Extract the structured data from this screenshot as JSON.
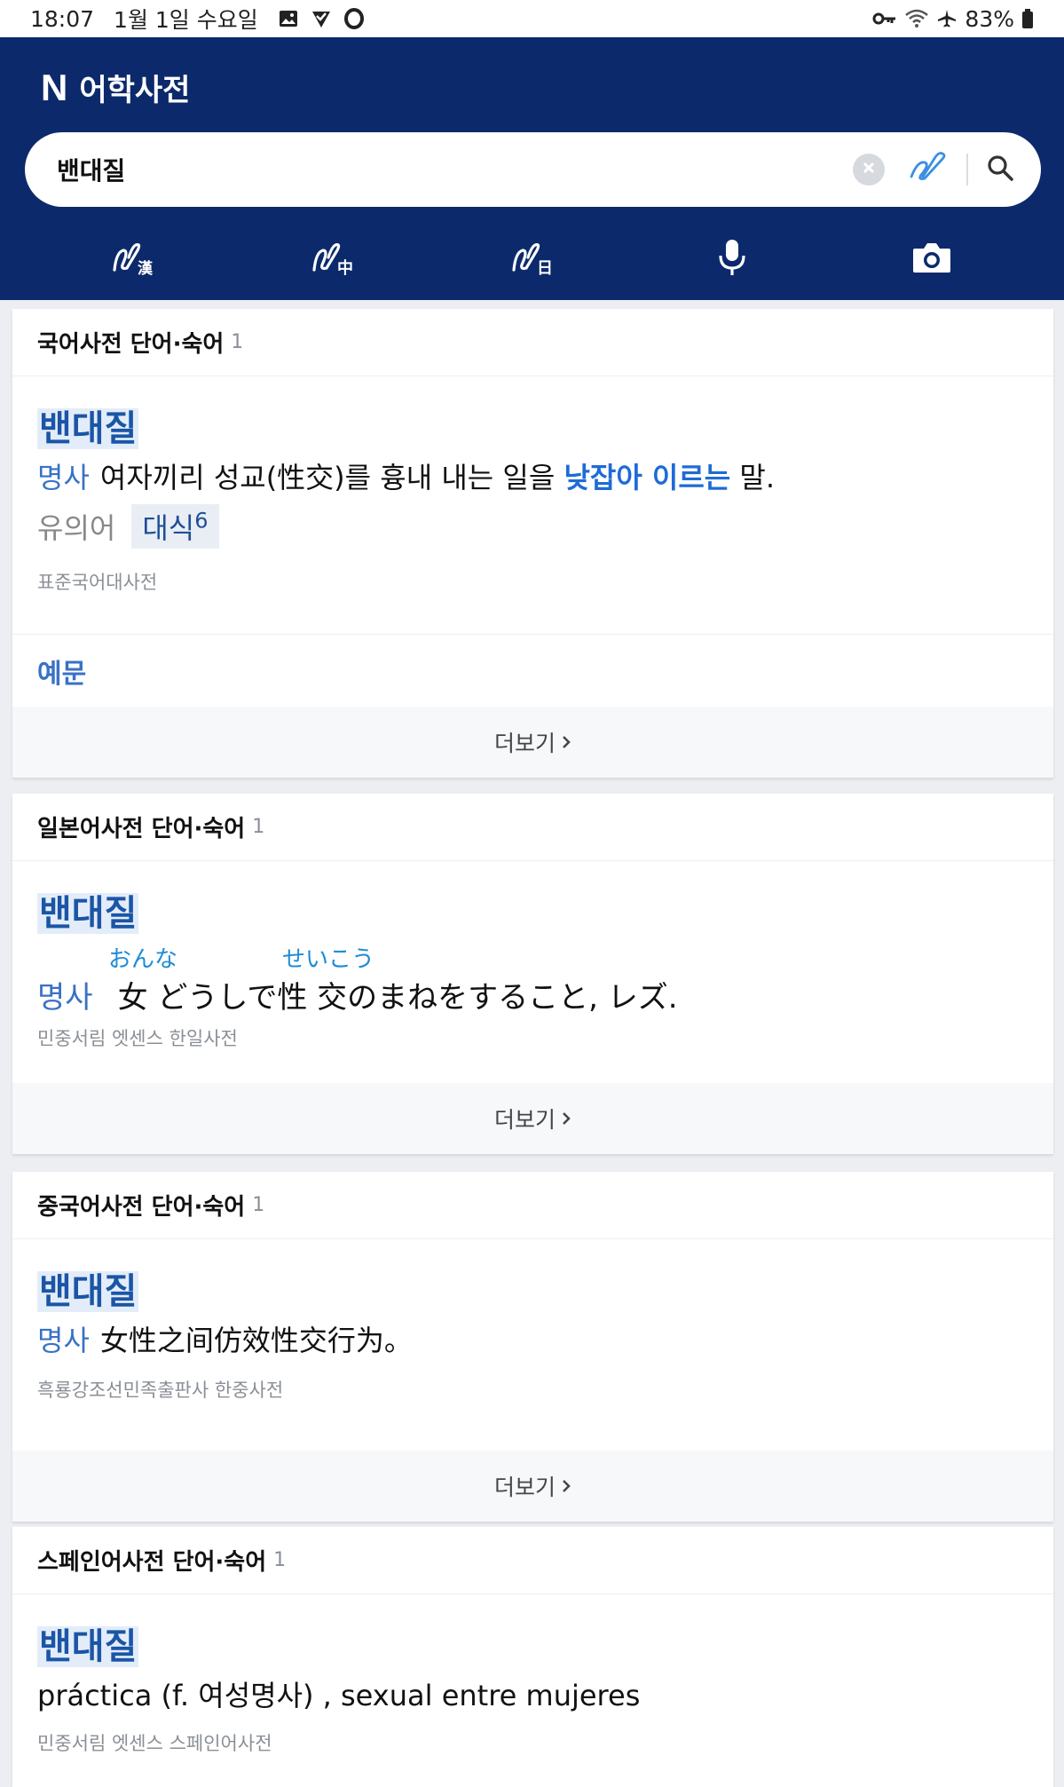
{
  "status": {
    "time": "18:07",
    "date": "1월 1일 수요일",
    "battery": "83%"
  },
  "header": {
    "logo": "N",
    "title": "어학사전"
  },
  "search": {
    "value": "밴대질"
  },
  "tools": [
    {
      "icon": "handwriting-hanja-icon"
    },
    {
      "icon": "handwriting-chinese-icon"
    },
    {
      "icon": "handwriting-japanese-icon"
    },
    {
      "icon": "microphone-icon"
    },
    {
      "icon": "camera-icon"
    }
  ],
  "cards": {
    "korean": {
      "title": "국어사전 단어·숙어",
      "count": "1",
      "headword": "밴대질",
      "pos": "명사",
      "def_a": "여자끼리 성교(性交)를 흉내 내는 일을",
      "def_hl": "낮잡아 이르는",
      "def_b": "말.",
      "syn_label": "유의어",
      "syn_word": "대식",
      "syn_sup": "6",
      "source": "표준국어대사전",
      "example_label": "예문",
      "more": "더보기"
    },
    "japanese": {
      "title": "일본어사전 단어·숙어",
      "count": "1",
      "headword": "밴대질",
      "pos": "명사",
      "furigana_1": "おんな",
      "furigana_2": "せいこう",
      "def": "女 どうしで性 交のまねをすること, レズ.",
      "source": "민중서림 엣센스 한일사전",
      "more": "더보기"
    },
    "chinese": {
      "title": "중국어사전 단어·숙어",
      "count": "1",
      "headword": "밴대질",
      "pos": "명사",
      "def": "女性之间仿效性交行为。",
      "source": "흑룡강조선민족출판사 한중사전",
      "more": "더보기"
    },
    "spanish": {
      "title": "스페인어사전 단어·숙어",
      "count": "1",
      "headword": "밴대질",
      "def": "práctica (f. 여성명사) , sexual entre mujeres",
      "source": "민중서림 엣센스 스페인어사전"
    }
  }
}
